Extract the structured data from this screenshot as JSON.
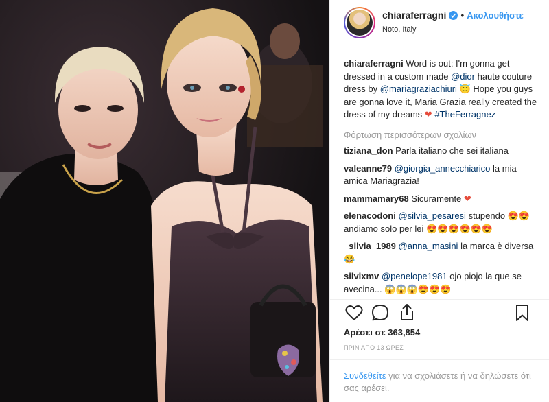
{
  "header": {
    "username": "chiaraferragni",
    "follow_label": "Ακολουθήστε",
    "separator": "•",
    "location": "Noto, Italy"
  },
  "caption": {
    "username": "chiaraferragni",
    "text_1": "Word is out: I'm gonna get dressed in a custom made",
    "mention_1": "@dior",
    "text_2": "haute couture dress by",
    "mention_2": "@mariagraziachiuri",
    "emoji_1": "😇",
    "text_3": "Hope you guys are gonna love it, Maria Grazia really created the dress of my dreams",
    "emoji_2": "❤",
    "hashtag": "#TheFerragnez"
  },
  "load_more_label": "Φόρτωση περισσότερων σχολίων",
  "comments": [
    {
      "user": "tiziana_don",
      "mention": "",
      "text": "Parla italiano che sei italiana",
      "emoji": ""
    },
    {
      "user": "valeanne79",
      "mention": "@giorgia_annecchiarico",
      "text": "la mia amica Mariagrazia!",
      "emoji": ""
    },
    {
      "user": "mammamary68",
      "mention": "",
      "text": "Sicuramente",
      "emoji": "❤"
    },
    {
      "user": "elenacodoni",
      "mention": "@silvia_pesaresi",
      "text": "stupendo 😍😍 andiamo solo per lei",
      "emoji": "😍😍😍😍😍😍"
    },
    {
      "user": "_silvia_1989",
      "mention": "@anna_masini",
      "text": "la marca è diversa",
      "emoji": "😂"
    },
    {
      "user": "silvixmv",
      "mention": "@penelope1981",
      "text": "ojo piojo la que se avecina...",
      "emoji": "😱😱😱😍😍😍"
    }
  ],
  "actions": {
    "like_icon": "heart-outline-icon",
    "comment_icon": "speech-bubble-icon",
    "share_icon": "share-arrow-icon",
    "save_icon": "bookmark-icon"
  },
  "likes_text": "Αρέσει σε 363,854",
  "timestamp": "ΠΡΙΝ ΑΠΟ 13 ΩΡΕΣ",
  "login": {
    "link": "Συνδεθείτε",
    "text": "για να σχολιάσετε ή να δηλώσετε ότι σας αρέσει."
  },
  "colors": {
    "link_blue": "#3897f0",
    "mention_blue": "#003569",
    "muted_gray": "#999999",
    "border": "#efefef"
  }
}
